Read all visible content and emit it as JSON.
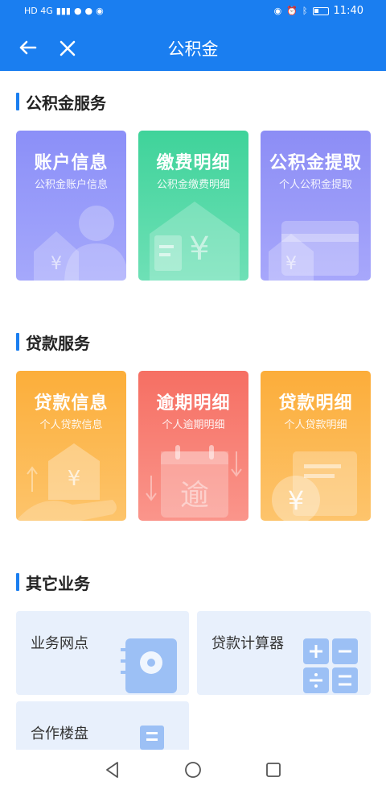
{
  "status_bar": {
    "network": "HD 4G",
    "time": "11:40"
  },
  "header": {
    "title": "公积金"
  },
  "sections": [
    {
      "title": "公积金服务",
      "cards": [
        {
          "title": "账户信息",
          "subtitle": "公积金账户信息",
          "color": "#8b8ff8",
          "icon": "person-icon"
        },
        {
          "title": "缴费明细",
          "subtitle": "公积金缴费明细",
          "color": "#3fd39a",
          "icon": "house-yen-icon"
        },
        {
          "title": "公积金提取",
          "subtitle": "个人公积金提取",
          "color": "#8c8df5",
          "icon": "card-house-icon"
        }
      ]
    },
    {
      "title": "贷款服务",
      "cards": [
        {
          "title": "贷款信息",
          "subtitle": "个人贷款信息",
          "color": "#fcae3a",
          "icon": "hand-house-icon"
        },
        {
          "title": "逾期明细",
          "subtitle": "个人逾期明细",
          "color": "#f66f63",
          "icon": "calendar-overdue-icon"
        },
        {
          "title": "贷款明细",
          "subtitle": "个人贷款明细",
          "color": "#fcad3a",
          "icon": "coin-document-icon"
        }
      ]
    },
    {
      "title": "其它业务",
      "tiles": [
        {
          "label": "业务网点",
          "icon": "location-book-icon"
        },
        {
          "label": "贷款计算器",
          "icon": "calculator-icon"
        },
        {
          "label": "合作楼盘",
          "icon": "building-icon"
        }
      ]
    }
  ],
  "nav": {
    "back": "back-triangle-icon",
    "home": "home-circle-icon",
    "recents": "recents-square-icon"
  }
}
